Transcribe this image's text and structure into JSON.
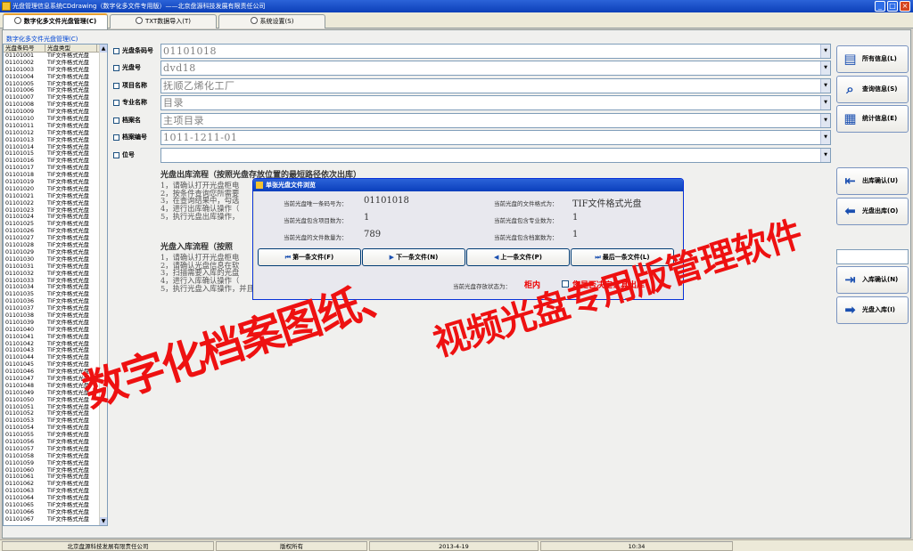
{
  "window": {
    "title": "光盘管理信息系统CDdrawing（数字化多文件专用版）——北京盘源科技发展有限责任公司",
    "controls": [
      "minimize",
      "maximize",
      "close"
    ]
  },
  "tabs": [
    {
      "label": "数字化多文件光盘管理(C)",
      "active": true
    },
    {
      "label": "TXT数据导入(T)",
      "active": false
    },
    {
      "label": "系统设置(S)",
      "active": false
    }
  ],
  "group_label": "数字化多文件光盘管理(C)",
  "list": {
    "headers": [
      "光盘条码号",
      "光盘类型"
    ],
    "type_value": "TIF文件格式光盘",
    "ids": [
      "01101001",
      "01101002",
      "01101003",
      "01101004",
      "01101005",
      "01101006",
      "01101007",
      "01101008",
      "01101009",
      "01101010",
      "01101011",
      "01101012",
      "01101013",
      "01101014",
      "01101015",
      "01101016",
      "01101017",
      "01101018",
      "01101019",
      "01101020",
      "01101021",
      "01101022",
      "01101023",
      "01101024",
      "01101025",
      "01101026",
      "01101027",
      "01101028",
      "01101029",
      "01101030",
      "01101031",
      "01101032",
      "01101033",
      "01101034",
      "01101035",
      "01101036",
      "01101037",
      "01101038",
      "01101039",
      "01101040",
      "01101041",
      "01101042",
      "01101043",
      "01101044",
      "01101045",
      "01101046",
      "01101047",
      "01101048",
      "01101049",
      "01101050",
      "01101051",
      "01101052",
      "01101053",
      "01101054",
      "01101055",
      "01101056",
      "01101057",
      "01101058",
      "01101059",
      "01101060",
      "01101061",
      "01101062",
      "01101063",
      "01101064",
      "01101065",
      "01101066",
      "01101067"
    ]
  },
  "fields": [
    {
      "label": "光盘条码号",
      "value": "01101018"
    },
    {
      "label": "光盘号",
      "value": "dvd18"
    },
    {
      "label": "项目名称",
      "value": "抚顺乙烯化工厂"
    },
    {
      "label": "专业名称",
      "value": "目录"
    },
    {
      "label": "档案名",
      "value": "主项目录"
    },
    {
      "label": "档案编号",
      "value": "1011-1211-01"
    },
    {
      "label": "位号",
      "value": ""
    }
  ],
  "procedures": {
    "out": {
      "heading": "光盘出库流程（按照光盘存放位置的最短路径依次出库）",
      "lines": [
        "1，请确认打开光盘柜电",
        "2，按条件查询您所需要",
        "3，在查询结果中，勾选",
        "4，进行出库确认操作（",
        "5，执行光盘出库操作，"
      ]
    },
    "in": {
      "heading": "光盘入库流程（按照",
      "lines": [
        "1，请确认打开光盘柜电",
        "2，请确认光盘信息在软",
        "3，扫描需要入库的光盘",
        "4，进行入库确认操作（",
        "5，执行光盘入库操作，并且到光盘柜前依次存放光盘。"
      ]
    }
  },
  "side_buttons": [
    {
      "label": "所有信息(L)",
      "icon": "folder-icon"
    },
    {
      "label": "查询信息(S)",
      "icon": "magnifier-icon"
    },
    {
      "label": "统计信息(E)",
      "icon": "cube-icon"
    },
    {
      "label": "出库确认(U)",
      "icon": "arrow-out-icon"
    },
    {
      "label": "光盘出库(O)",
      "icon": "arrow-left-icon"
    },
    {
      "label": "入库确认(N)",
      "icon": "arrow-in-icon"
    },
    {
      "label": "光盘入库(I)",
      "icon": "arrow-right-icon"
    }
  ],
  "dialog": {
    "title": "单张光盘文件浏览",
    "left": [
      {
        "label": "当前光盘唯一条码号为：",
        "value": "01101018"
      },
      {
        "label": "当前光盘包含项目数为：",
        "value": "1"
      },
      {
        "label": "当前光盘的文件数量为：",
        "value": "789"
      }
    ],
    "right": [
      {
        "label": "当前光盘的文件格式为：",
        "value": "TIF文件格式光盘"
      },
      {
        "label": "当前光盘包含专业数为：",
        "value": "1"
      },
      {
        "label": "当前光盘包含档案数为：",
        "value": "1"
      }
    ],
    "buttons": [
      "第一条文件(F)",
      "下一条文件(N)",
      "上一条文件(P)",
      "最后一条文件(L)"
    ],
    "storage_label": "当前光盘存放状态为：",
    "storage_value": "柜内",
    "checkbox_label": "您是否决定让其出库"
  },
  "status": [
    "北京盘源科技发展有限责任公司",
    "版权所有",
    "2013-4-19",
    "10:34"
  ],
  "watermark": {
    "line1": "数字化档案图纸、",
    "line2": "视频光盘专用版管理软件"
  }
}
